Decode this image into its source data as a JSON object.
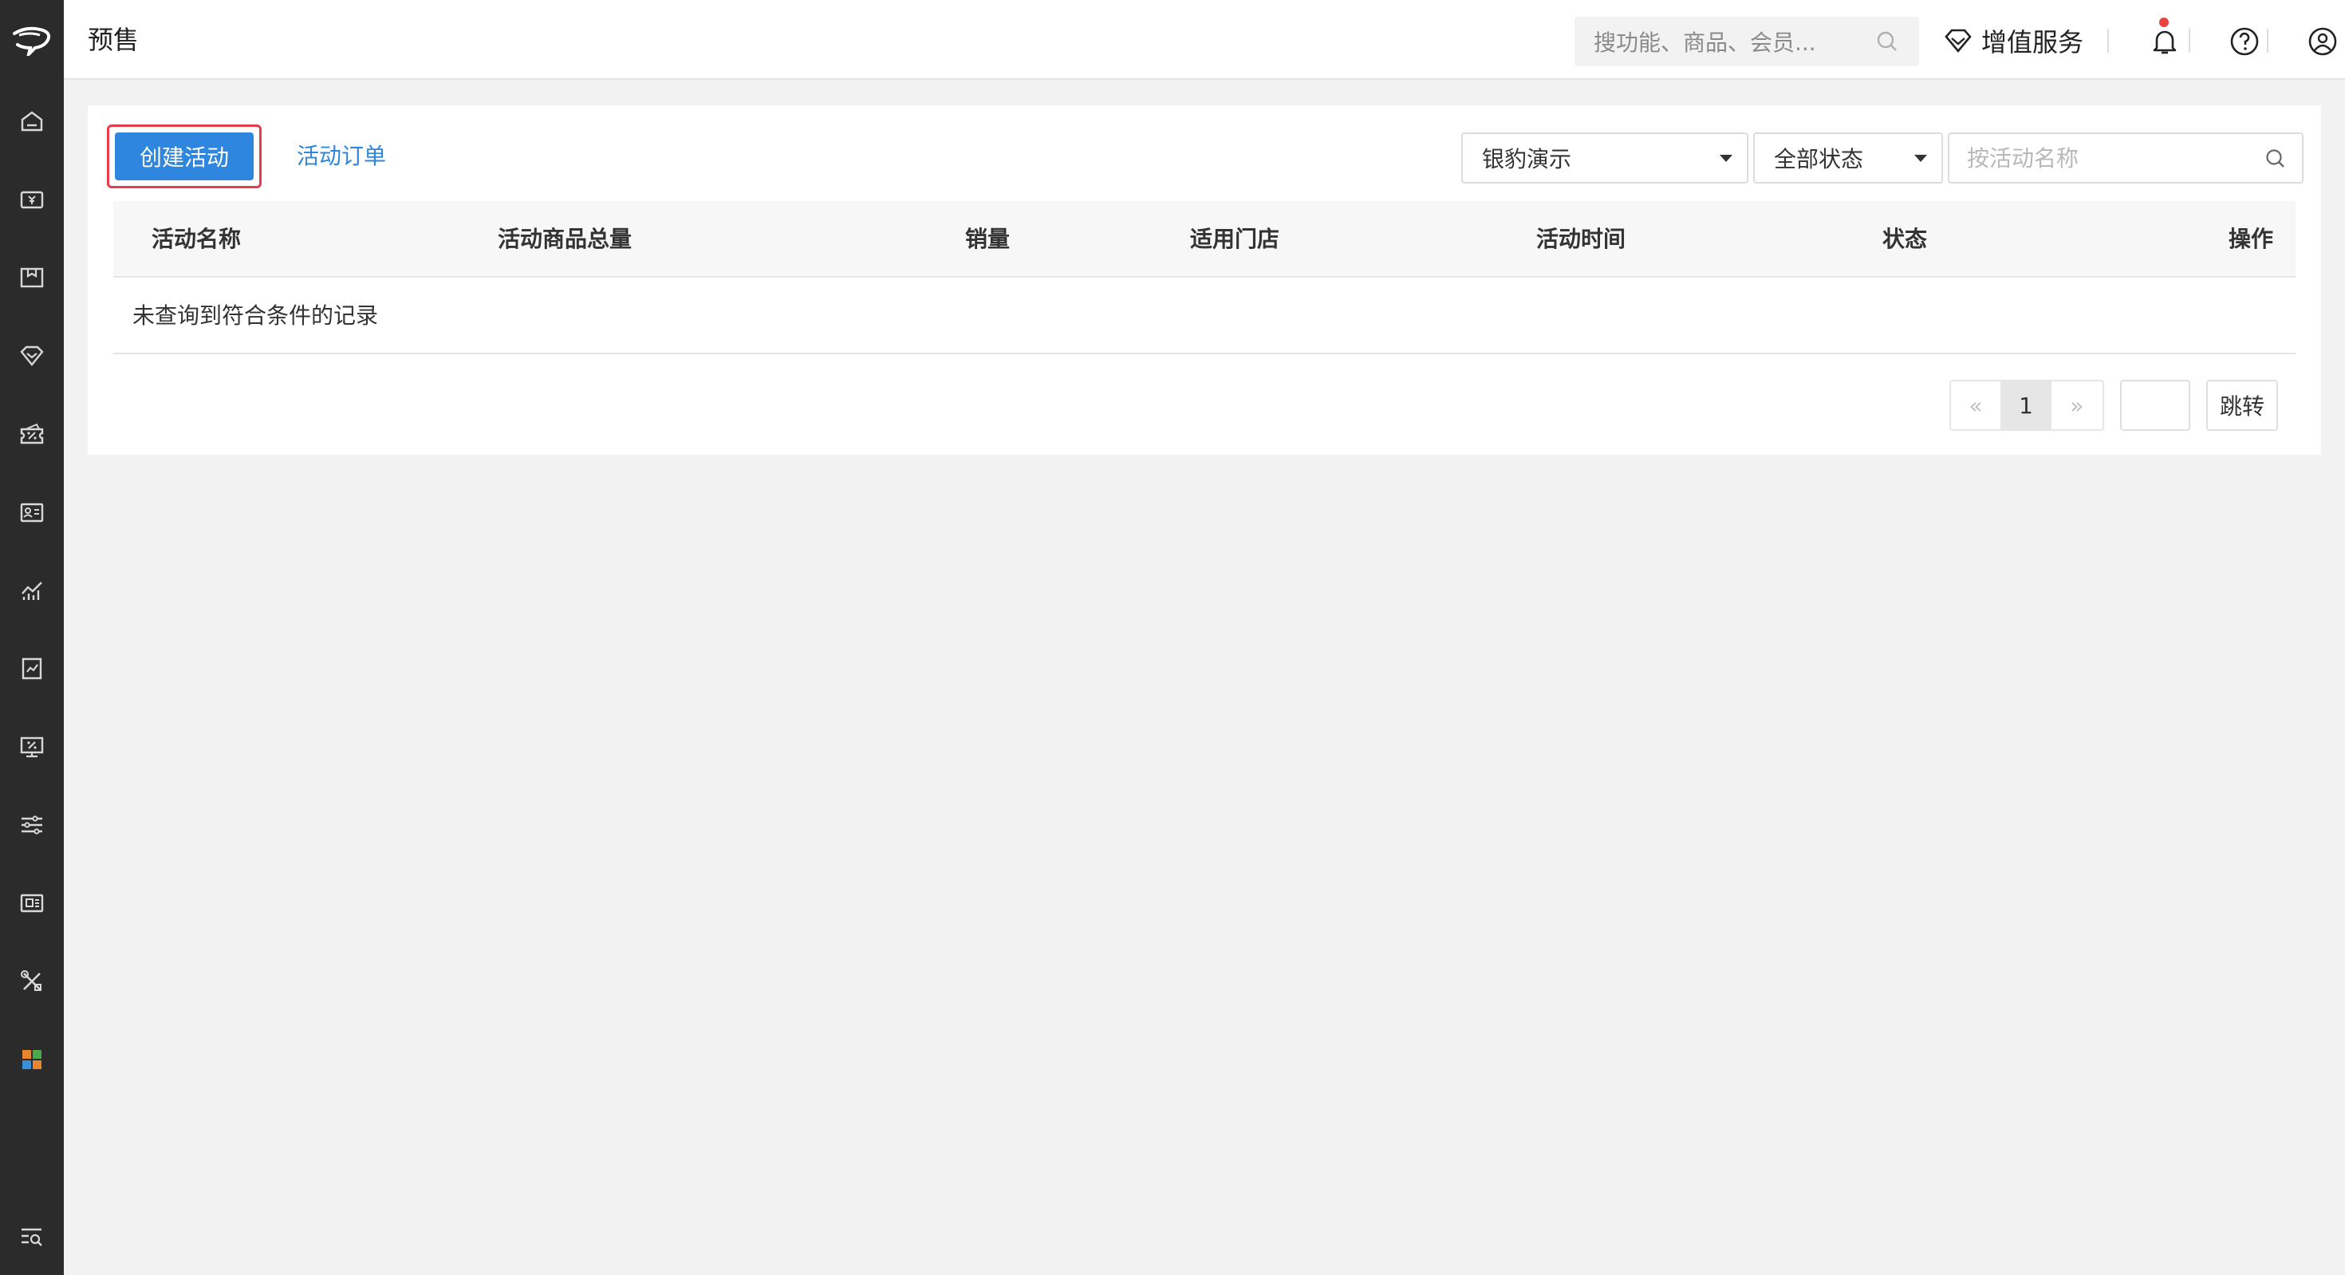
{
  "header": {
    "title": "预售",
    "search_placeholder": "搜功能、商品、会员...",
    "value_added_service": "增值服务",
    "notification_dot": true
  },
  "sidebar": {
    "items": [
      {
        "icon": "home-icon"
      },
      {
        "icon": "cashier-icon"
      },
      {
        "icon": "goods-icon"
      },
      {
        "icon": "member-icon"
      },
      {
        "icon": "marketing-icon"
      },
      {
        "icon": "staff-icon"
      },
      {
        "icon": "analytics-icon"
      },
      {
        "icon": "report-icon"
      },
      {
        "icon": "promotion-icon"
      },
      {
        "icon": "settings-sliders-icon"
      },
      {
        "icon": "app-store-icon"
      },
      {
        "icon": "tools-icon"
      },
      {
        "icon": "apps-grid-icon"
      },
      {
        "icon": "search-menu-icon"
      }
    ]
  },
  "toolbar": {
    "create_label": "创建活动",
    "orders_label": "活动订单",
    "store_select": "银豹演示",
    "status_select": "全部状态",
    "search_placeholder": "按活动名称"
  },
  "table": {
    "columns": [
      "活动名称",
      "活动商品总量",
      "销量",
      "适用门店",
      "活动时间",
      "状态",
      "操作"
    ],
    "empty_text": "未查询到符合条件的记录",
    "rows": []
  },
  "pagination": {
    "prev": "«",
    "current": "1",
    "next": "»",
    "jump_label": "跳转"
  },
  "colors": {
    "primary": "#2e86de",
    "highlight_border": "#e63c4c",
    "sidebar_bg": "#2b2b2b",
    "notification": "#e94040"
  }
}
